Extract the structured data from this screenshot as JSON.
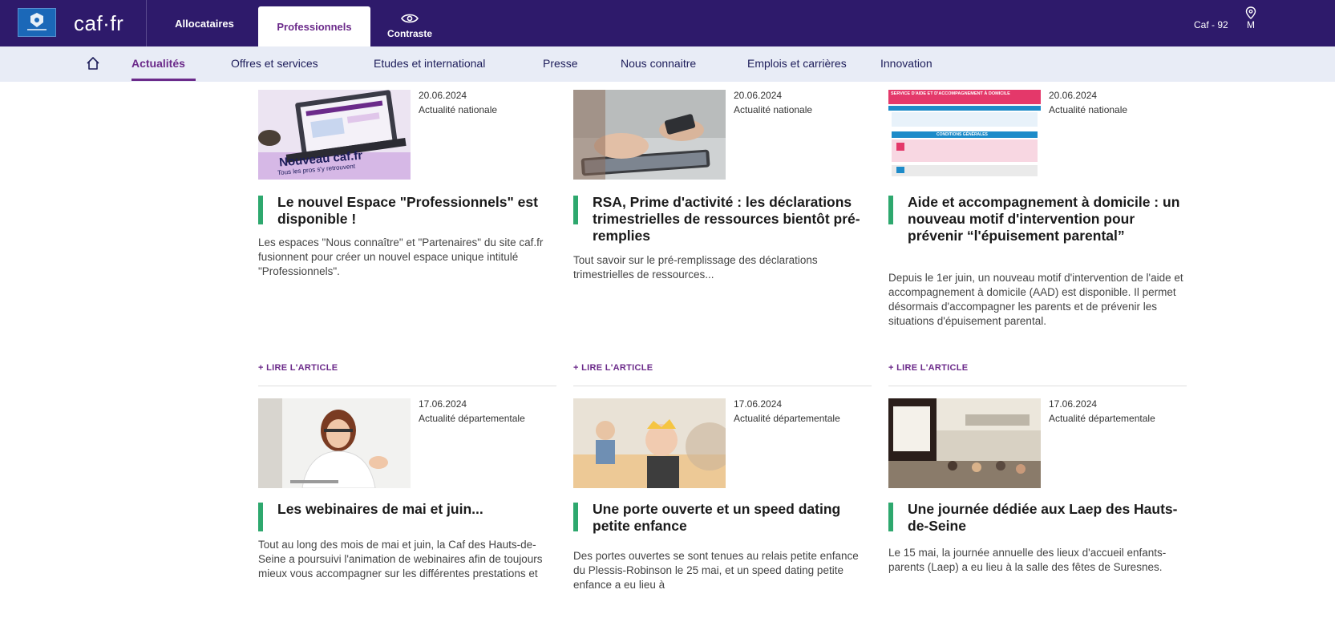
{
  "header": {
    "site_name": "caf·fr",
    "tabs": [
      {
        "label": "Allocataires"
      },
      {
        "label": "Professionnels"
      }
    ],
    "contrast_label": "Contraste",
    "location_label": "Caf - 92",
    "location_suffix": "M"
  },
  "subnav": {
    "items": [
      {
        "label": "Actualités"
      },
      {
        "label": "Offres et services"
      },
      {
        "label": "Etudes et international"
      },
      {
        "label": "Presse"
      },
      {
        "label": "Nous connaitre"
      },
      {
        "label": "Emplois et carrières"
      },
      {
        "label": "Innovation"
      }
    ]
  },
  "articles": [
    {
      "date": "20.06.2024",
      "category": "Actualité nationale",
      "title": "Le nouvel Espace \"Professionnels\" est disponible !",
      "description": "Les espaces \"Nous connaître\" et \"Partenaires\" du site caf.fr fusionnent pour créer un nouvel espace unique intitulé \"Professionnels\".",
      "link_label": "+ LIRE L'ARTICLE",
      "thumb_text_1": "Nouveau caf.fr",
      "thumb_text_2": "Tous les pros s'y retrouvent"
    },
    {
      "date": "20.06.2024",
      "category": "Actualité nationale",
      "title": "RSA, Prime d'activité : les déclarations trimestrielles de ressources bientôt pré-remplies",
      "description": "Tout savoir sur le pré-remplissage des déclarations trimestrielles de ressources...",
      "link_label": "+ LIRE L'ARTICLE"
    },
    {
      "date": "20.06.2024",
      "category": "Actualité nationale",
      "title": "Aide et accompagnement à domicile : un nouveau motif d'intervention pour prévenir “l'épuisement parental”",
      "description": "Depuis le 1er juin, un nouveau motif d'intervention de l'aide et accompagnement à domicile (AAD) est disponible. Il permet désormais d'accompagner les parents et de prévenir les situations d'épuisement parental.",
      "link_label": "+ LIRE L'ARTICLE",
      "thumb_text_1": "SERVICE D'AIDE ET D'ACCOMPAGNEMENT À DOMICILE",
      "thumb_text_2": "CONDITIONS GÉNÉRALES"
    },
    {
      "date": "17.06.2024",
      "category": "Actualité départementale",
      "title": "Les webinaires de mai et juin...",
      "description": "Tout au long des mois de mai et juin, la Caf des Hauts-de-Seine a poursuivi l'animation de webinaires afin de toujours mieux vous accompagner sur les différentes prestations et"
    },
    {
      "date": "17.06.2024",
      "category": "Actualité départementale",
      "title": "Une porte ouverte et un speed dating petite enfance",
      "description": "Des portes ouvertes se sont tenues au relais petite enfance du Plessis-Robinson le 25 mai, et un speed dating petite enfance a eu lieu à"
    },
    {
      "date": "17.06.2024",
      "category": "Actualité départementale",
      "title": "Une journée dédiée aux Laep des Hauts-de-Seine",
      "description": "Le 15 mai, la journée annuelle des lieux d'accueil enfants-parents (Laep) a eu lieu à la salle des fêtes de Suresnes."
    }
  ]
}
